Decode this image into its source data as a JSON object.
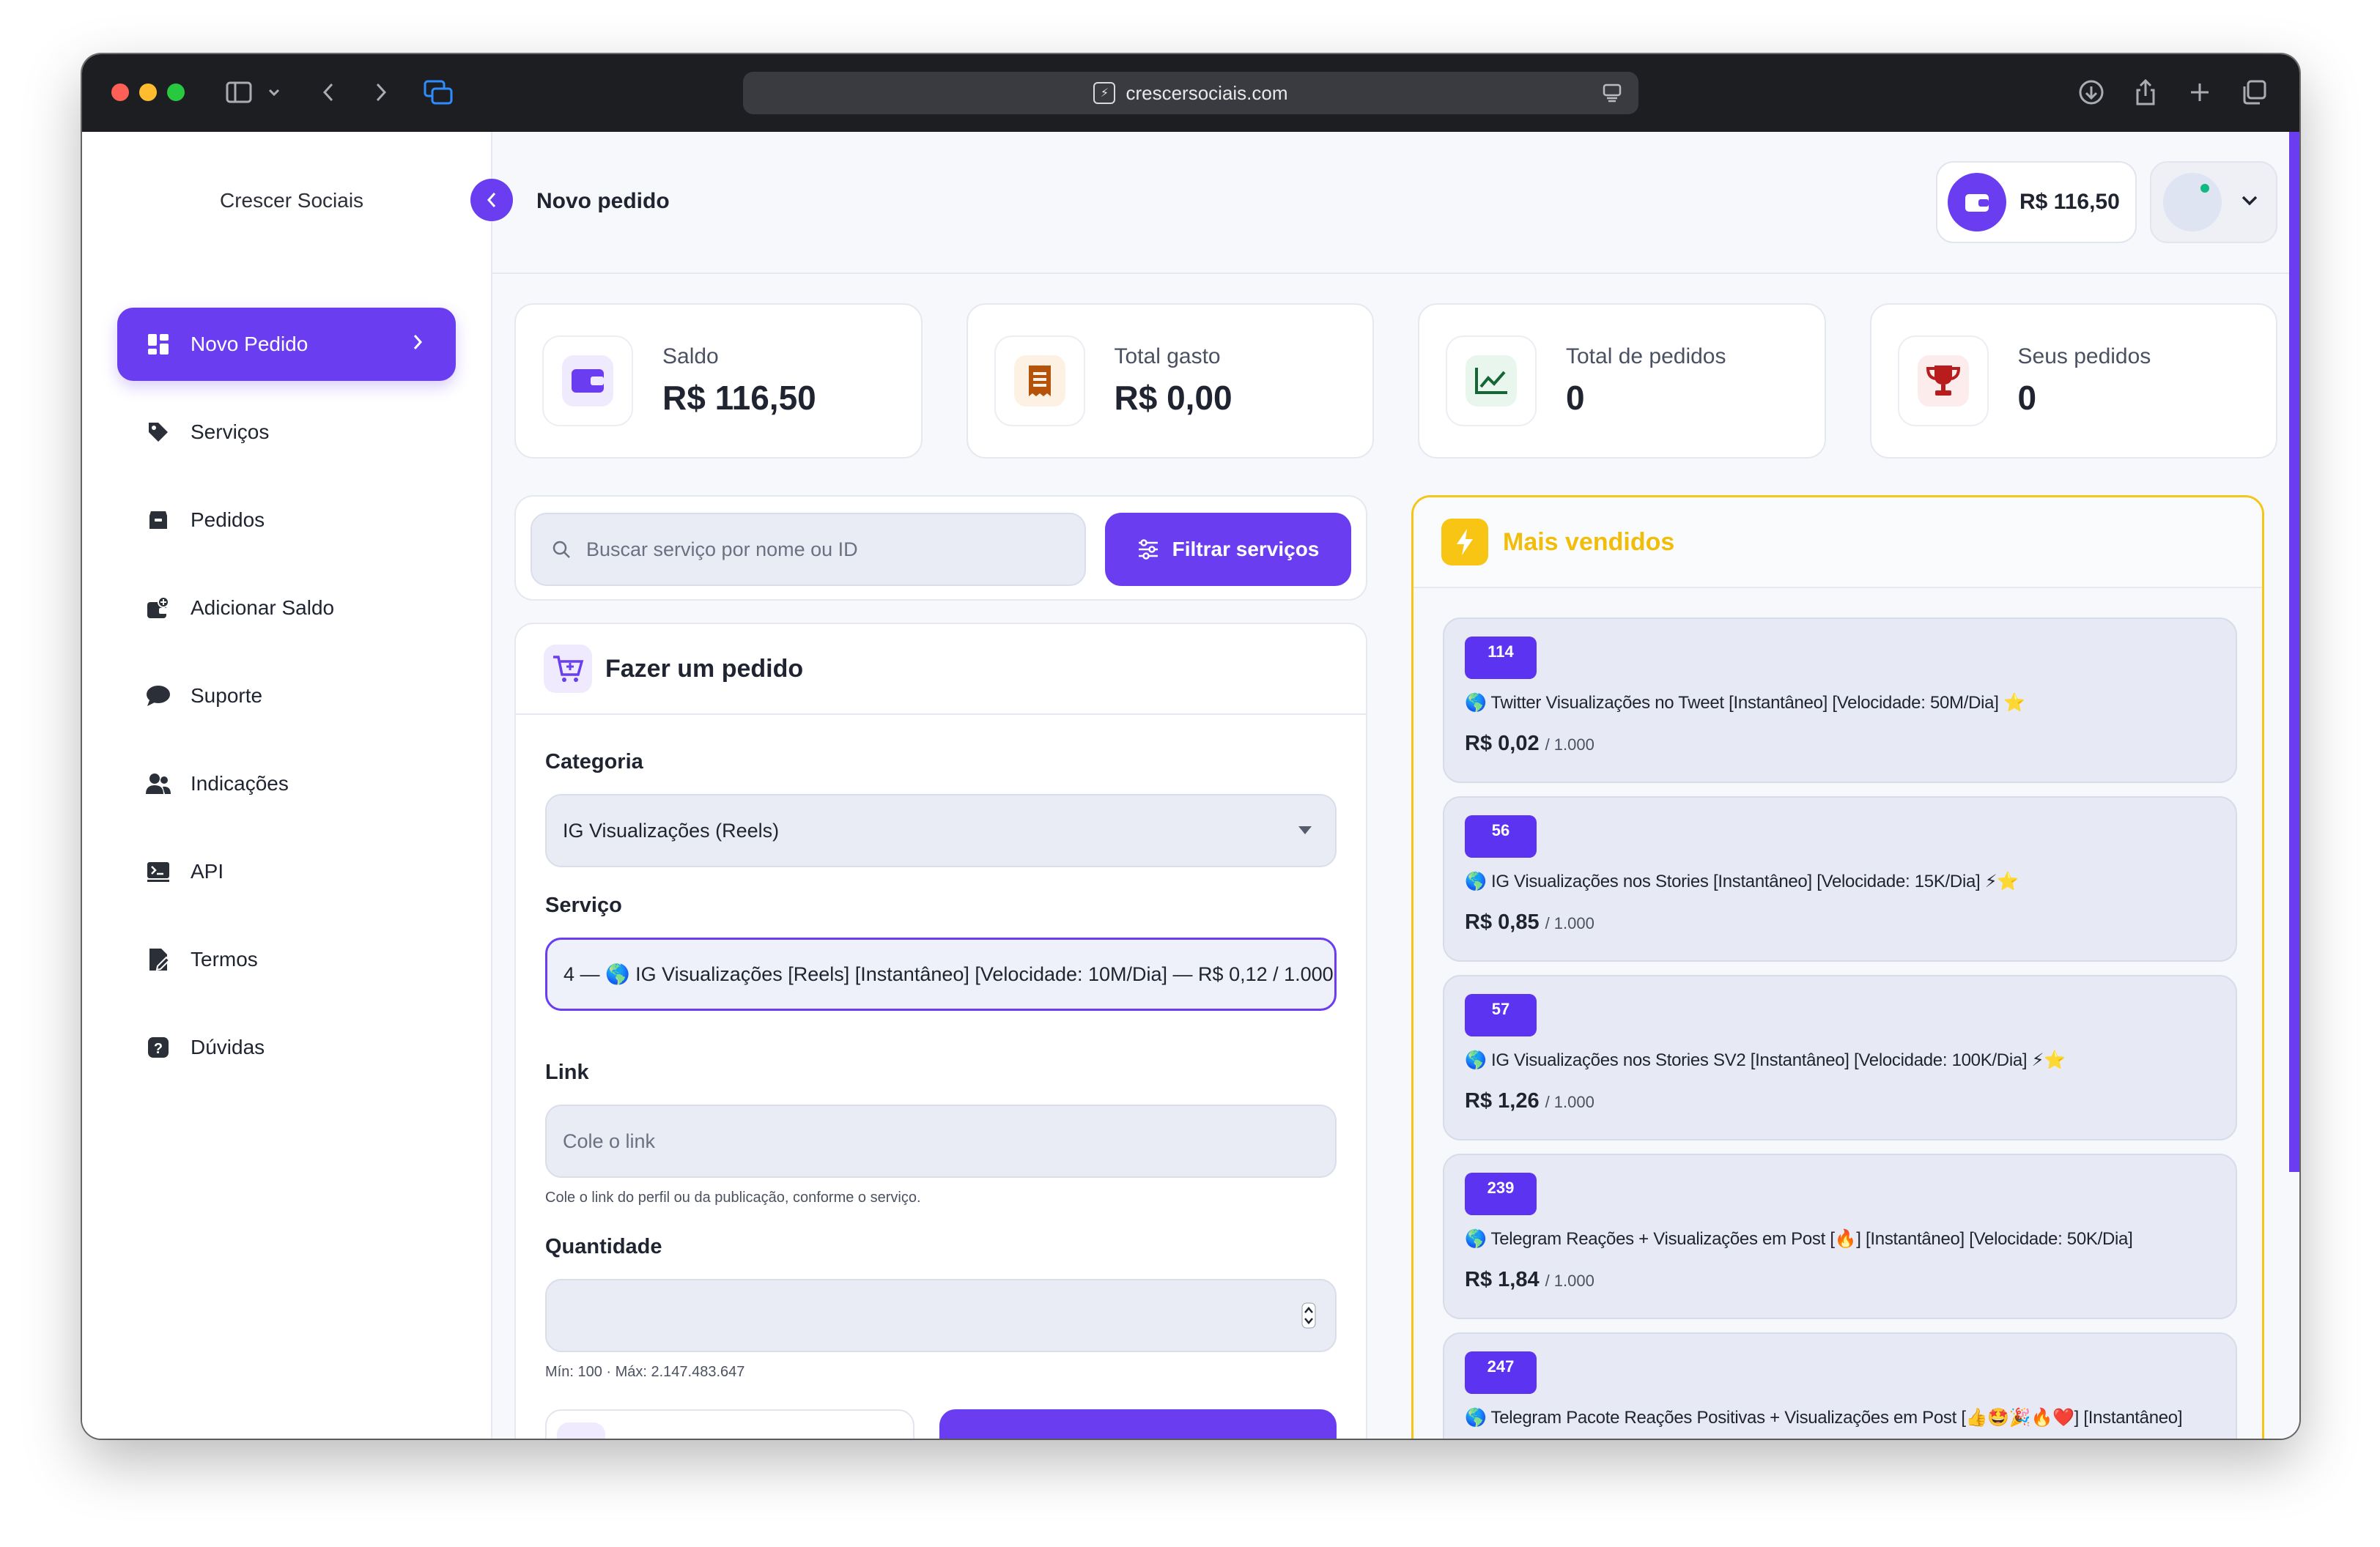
{
  "browser": {
    "url": "crescersociais.com"
  },
  "sidebar": {
    "brand": "Crescer Sociais",
    "items": [
      {
        "label": "Novo Pedido",
        "icon": "dashboard-icon",
        "active": true
      },
      {
        "label": "Serviços",
        "icon": "tag-icon"
      },
      {
        "label": "Pedidos",
        "icon": "box-icon"
      },
      {
        "label": "Adicionar Saldo",
        "icon": "wallet-add-icon"
      },
      {
        "label": "Suporte",
        "icon": "chat-icon"
      },
      {
        "label": "Indicações",
        "icon": "users-icon"
      },
      {
        "label": "API",
        "icon": "terminal-icon"
      },
      {
        "label": "Termos",
        "icon": "document-icon"
      },
      {
        "label": "Dúvidas",
        "icon": "help-icon"
      }
    ]
  },
  "header": {
    "title": "Novo pedido",
    "balance": "R$ 116,50"
  },
  "stats": [
    {
      "label": "Saldo",
      "value": "R$ 116,50",
      "icon": "wallet-icon",
      "color": "#6a3df0"
    },
    {
      "label": "Total gasto",
      "value": "R$ 0,00",
      "icon": "receipt-icon",
      "color": "#b45309"
    },
    {
      "label": "Total de pedidos",
      "value": "0",
      "icon": "chart-line-icon",
      "color": "#166534"
    },
    {
      "label": "Seus pedidos",
      "value": "0",
      "icon": "trophy-icon",
      "color": "#b91c1c"
    }
  ],
  "search": {
    "placeholder": "Buscar serviço por nome ou ID",
    "filter_label": "Filtrar serviços"
  },
  "order": {
    "title": "Fazer um pedido",
    "category_label": "Categoria",
    "category_value": "IG Visualizações (Reels)",
    "service_label": "Serviço",
    "service_value": "4 — 🌎 IG Visualizações [Reels] [Instantâneo] [Velocidade: 10M/Dia] — R$ 0,12 / 1.000",
    "link_label": "Link",
    "link_placeholder": "Cole o link",
    "link_help": "Cole o link do perfil ou da publicação, conforme o serviço.",
    "quantity_label": "Quantidade",
    "quantity_help": "Mín: 100 · Máx: 2.147.483.647"
  },
  "best_sellers": {
    "title": "Mais vendidos",
    "items": [
      {
        "id": "114",
        "name": "🌎 Twitter Visualizações no Tweet [Instantâneo] [Velocidade: 50M/Dia] ⭐",
        "price": "R$ 0,02",
        "unit": "/ 1.000"
      },
      {
        "id": "56",
        "name": "🌎 IG Visualizações nos Stories [Instantâneo] [Velocidade: 15K/Dia] ⚡⭐",
        "price": "R$ 0,85",
        "unit": "/ 1.000"
      },
      {
        "id": "57",
        "name": "🌎 IG Visualizações nos Stories SV2 [Instantâneo] [Velocidade: 100K/Dia] ⚡⭐",
        "price": "R$ 1,26",
        "unit": "/ 1.000"
      },
      {
        "id": "239",
        "name": "🌎 Telegram Reações + Visualizações em Post [🔥] [Instantâneo] [Velocidade: 50K/Dia]",
        "price": "R$ 1,84",
        "unit": "/ 1.000"
      },
      {
        "id": "247",
        "name": "🌎 Telegram Pacote Reações Positivas + Visualizações em Post [👍🤩🎉🔥❤️] [Instantâneo]",
        "price": "",
        "unit": ""
      }
    ]
  }
}
